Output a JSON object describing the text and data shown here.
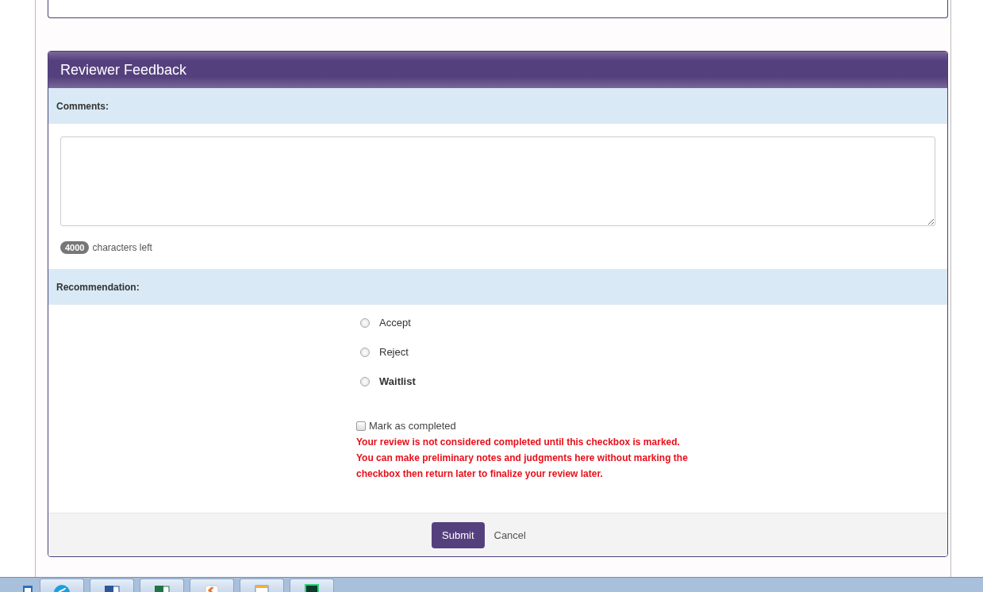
{
  "panel": {
    "title": "Reviewer Feedback"
  },
  "comments": {
    "label": "Comments:",
    "counter": "4000",
    "counter_text": "characters left"
  },
  "recommendation": {
    "label": "Recommendation:",
    "options": [
      {
        "label": "Accept",
        "selected": false,
        "highlighted": false
      },
      {
        "label": "Reject",
        "selected": false,
        "highlighted": false
      },
      {
        "label": "Waitlist",
        "selected": false,
        "highlighted": true
      }
    ]
  },
  "completed": {
    "label": "Mark as completed",
    "checked": false,
    "warning_lines": [
      "Your review is not considered completed until this checkbox is marked.",
      "You can make preliminary notes and judgments here without marking the",
      "checkbox then return later to finalize your review later."
    ]
  },
  "buttons": {
    "submit": "Submit",
    "cancel": "Cancel"
  }
}
